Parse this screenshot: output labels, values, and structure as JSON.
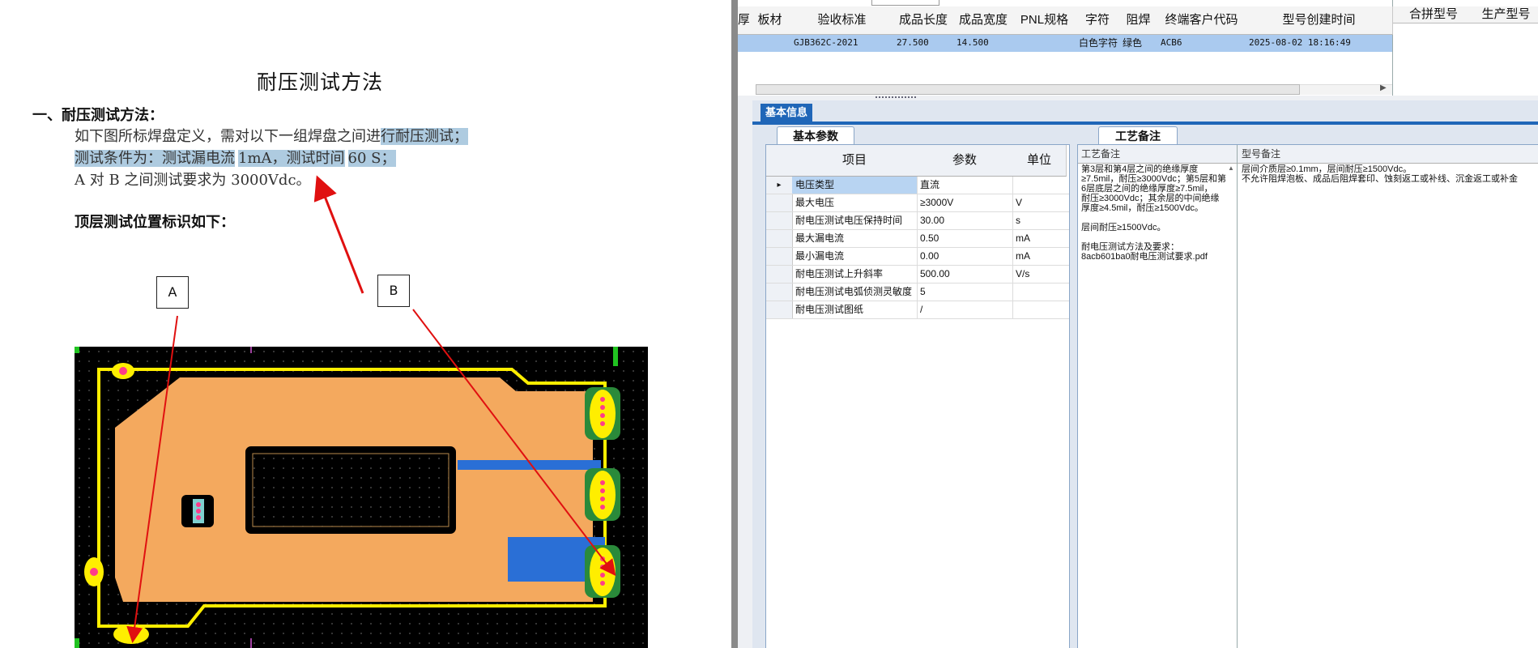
{
  "document": {
    "title": "耐压测试方法",
    "section_heading": "一、耐压测试方法：",
    "para1_plain": "如下图所标焊盘定义，需对以下一组焊盘之间进",
    "para1_hl": "行耐压测试；",
    "para2_hl1": "测试条件为：测试漏电流",
    "para2_v1": "1mA",
    "para2_mid": "，测试时间",
    "para2_v2": "60 S",
    "para2_end": "；",
    "para3": "A 对 B 之间测试要求为 3000Vdc。",
    "top_layer_heading": "顶层测试位置标识如下：",
    "label_a": "A",
    "label_b": "B"
  },
  "grid": {
    "headers": [
      "厚",
      "板材",
      "验收标准",
      "成品长度",
      "成品宽度",
      "PNL规格",
      "字符",
      "阻焊",
      "终端客户代码",
      "型号创建时间"
    ],
    "row": [
      "",
      "",
      "GJB362C-2021",
      "27.500",
      "14.500",
      "",
      "白色字符",
      "绿色",
      "ACB6",
      "2025-08-02 18:16:49"
    ],
    "side_headers": [
      "合拼型号",
      "生产型号"
    ]
  },
  "tabs": {
    "basic_info": "基本信息",
    "basic_params": "基本参数",
    "process_notes": "工艺备注"
  },
  "params": {
    "headers": [
      "项目",
      "参数",
      "单位"
    ],
    "rows": [
      {
        "item": "电压类型",
        "value": "直流",
        "unit": ""
      },
      {
        "item": "最大电压",
        "value": "≥3000V",
        "unit": "V"
      },
      {
        "item": "耐电压测试电压保持时间",
        "value": "30.00",
        "unit": "s"
      },
      {
        "item": "最大漏电流",
        "value": "0.50",
        "unit": "mA"
      },
      {
        "item": "最小漏电流",
        "value": "0.00",
        "unit": "mA"
      },
      {
        "item": "耐电压测试上升斜率",
        "value": "500.00",
        "unit": "V/s"
      },
      {
        "item": "耐电压测试电弧侦测灵敏度",
        "value": "5",
        "unit": ""
      },
      {
        "item": "耐电压测试图纸",
        "value": "/",
        "unit": ""
      }
    ]
  },
  "notes": {
    "process_head": "工艺备注",
    "model_head": "型号备注",
    "process_text": "第3层和第4层之间的绝缘厚度≥7.5mil，耐压≥3000Vdc；第5层和第6层底层之间的绝缘厚度≥7.5mil，\n耐压≥3000Vdc；其余层的中间绝缘厚度≥4.5mil，耐压≥1500Vdc。\n\n层间耐压≥1500Vdc。\n\n耐电压测试方法及要求：\n8acb601ba0耐电压测试要求.pdf",
    "model_text": "层间介质层≥0.1mm，层间耐压≥1500Vdc。\n不允许阻焊泡板、成品后阻焊套印、蚀刻返工或补线、沉金返工或补金"
  },
  "colors": {
    "highlight": "#aecbe0",
    "accent_blue": "#1f66b8",
    "selected_row": "#aacaef",
    "pcb_copper": "#f4a95e",
    "pcb_outline": "#ffee00",
    "arrow_red": "#e01010"
  }
}
